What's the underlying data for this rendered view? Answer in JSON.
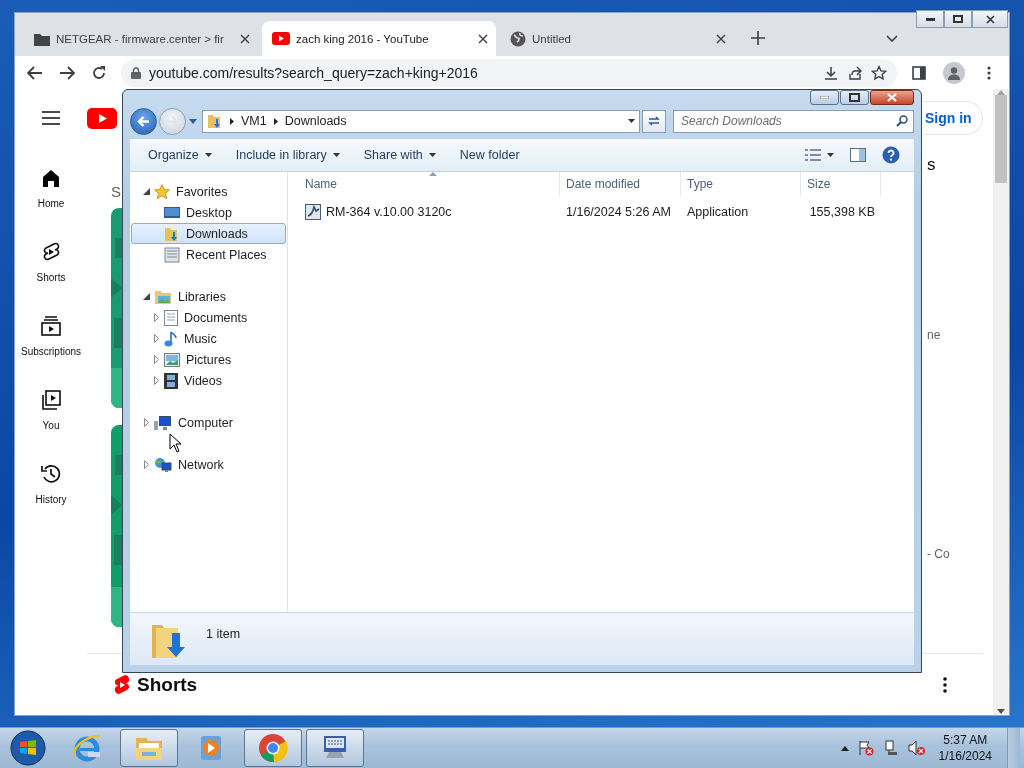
{
  "browser": {
    "tabs": [
      {
        "title": "NETGEAR - firmware.center > fir",
        "kind": "folder",
        "selected": false
      },
      {
        "title": "zach king 2016 - YouTube",
        "kind": "youtube",
        "selected": true
      },
      {
        "title": "Untitled",
        "kind": "globe",
        "selected": false
      }
    ],
    "address": "youtube.com/results?search_query=zach+king+2016",
    "sidebar": [
      {
        "label": "Home",
        "kind": "home"
      },
      {
        "label": "Shorts",
        "kind": "shorts"
      },
      {
        "label": "Subscriptions",
        "kind": "subscriptions"
      },
      {
        "label": "You",
        "kind": "you"
      },
      {
        "label": "History",
        "kind": "history"
      }
    ],
    "sign_in": "Sign in",
    "left_fragment": "S",
    "right_fragments": [
      "s",
      "ne",
      "- Co"
    ],
    "shelf_heading": "Shorts"
  },
  "explorer": {
    "breadcrumb": [
      "VM1",
      "Downloads"
    ],
    "search_placeholder": "Search Downloads",
    "commands": [
      {
        "label": "Organize",
        "dropdown": true
      },
      {
        "label": "Include in library",
        "dropdown": true
      },
      {
        "label": "Share with",
        "dropdown": true
      },
      {
        "label": "New folder",
        "dropdown": false
      }
    ],
    "nav": [
      {
        "label": "Favorites",
        "kind": "star",
        "expanded": true,
        "selected": false,
        "children": [
          {
            "label": "Desktop",
            "kind": "desktop",
            "selected": false
          },
          {
            "label": "Downloads",
            "kind": "downloads",
            "selected": true
          },
          {
            "label": "Recent Places",
            "kind": "recent",
            "selected": false
          }
        ]
      },
      {
        "label": "Libraries",
        "kind": "library",
        "expanded": true,
        "selected": false,
        "children": [
          {
            "label": "Documents",
            "kind": "documents",
            "expanded": false,
            "selected": false
          },
          {
            "label": "Music",
            "kind": "music",
            "expanded": false,
            "selected": false
          },
          {
            "label": "Pictures",
            "kind": "pictures",
            "expanded": false,
            "selected": false
          },
          {
            "label": "Videos",
            "kind": "videos",
            "expanded": false,
            "selected": false
          }
        ]
      },
      {
        "label": "Computer",
        "kind": "computer",
        "expanded": false,
        "selected": false
      },
      {
        "label": "Network",
        "kind": "network",
        "expanded": false,
        "selected": false
      }
    ],
    "columns": [
      {
        "label": "Name",
        "sorted": true
      },
      {
        "label": "Date modified",
        "sorted": false
      },
      {
        "label": "Type",
        "sorted": false
      },
      {
        "label": "Size",
        "sorted": false
      }
    ],
    "files": [
      {
        "name": "RM-364 v.10.00 3120c",
        "date": "1/16/2024 5:26 AM",
        "type": "Application",
        "size": "155,398 KB"
      }
    ],
    "status": "1 item"
  },
  "taskbar": {
    "apps": [
      {
        "kind": "ie",
        "running": false
      },
      {
        "kind": "explorer",
        "running": true
      },
      {
        "kind": "media",
        "running": false
      },
      {
        "kind": "chrome",
        "running": true
      },
      {
        "kind": "keyboard",
        "running": true
      }
    ],
    "time": "5:37 AM",
    "date": "1/16/2024"
  }
}
